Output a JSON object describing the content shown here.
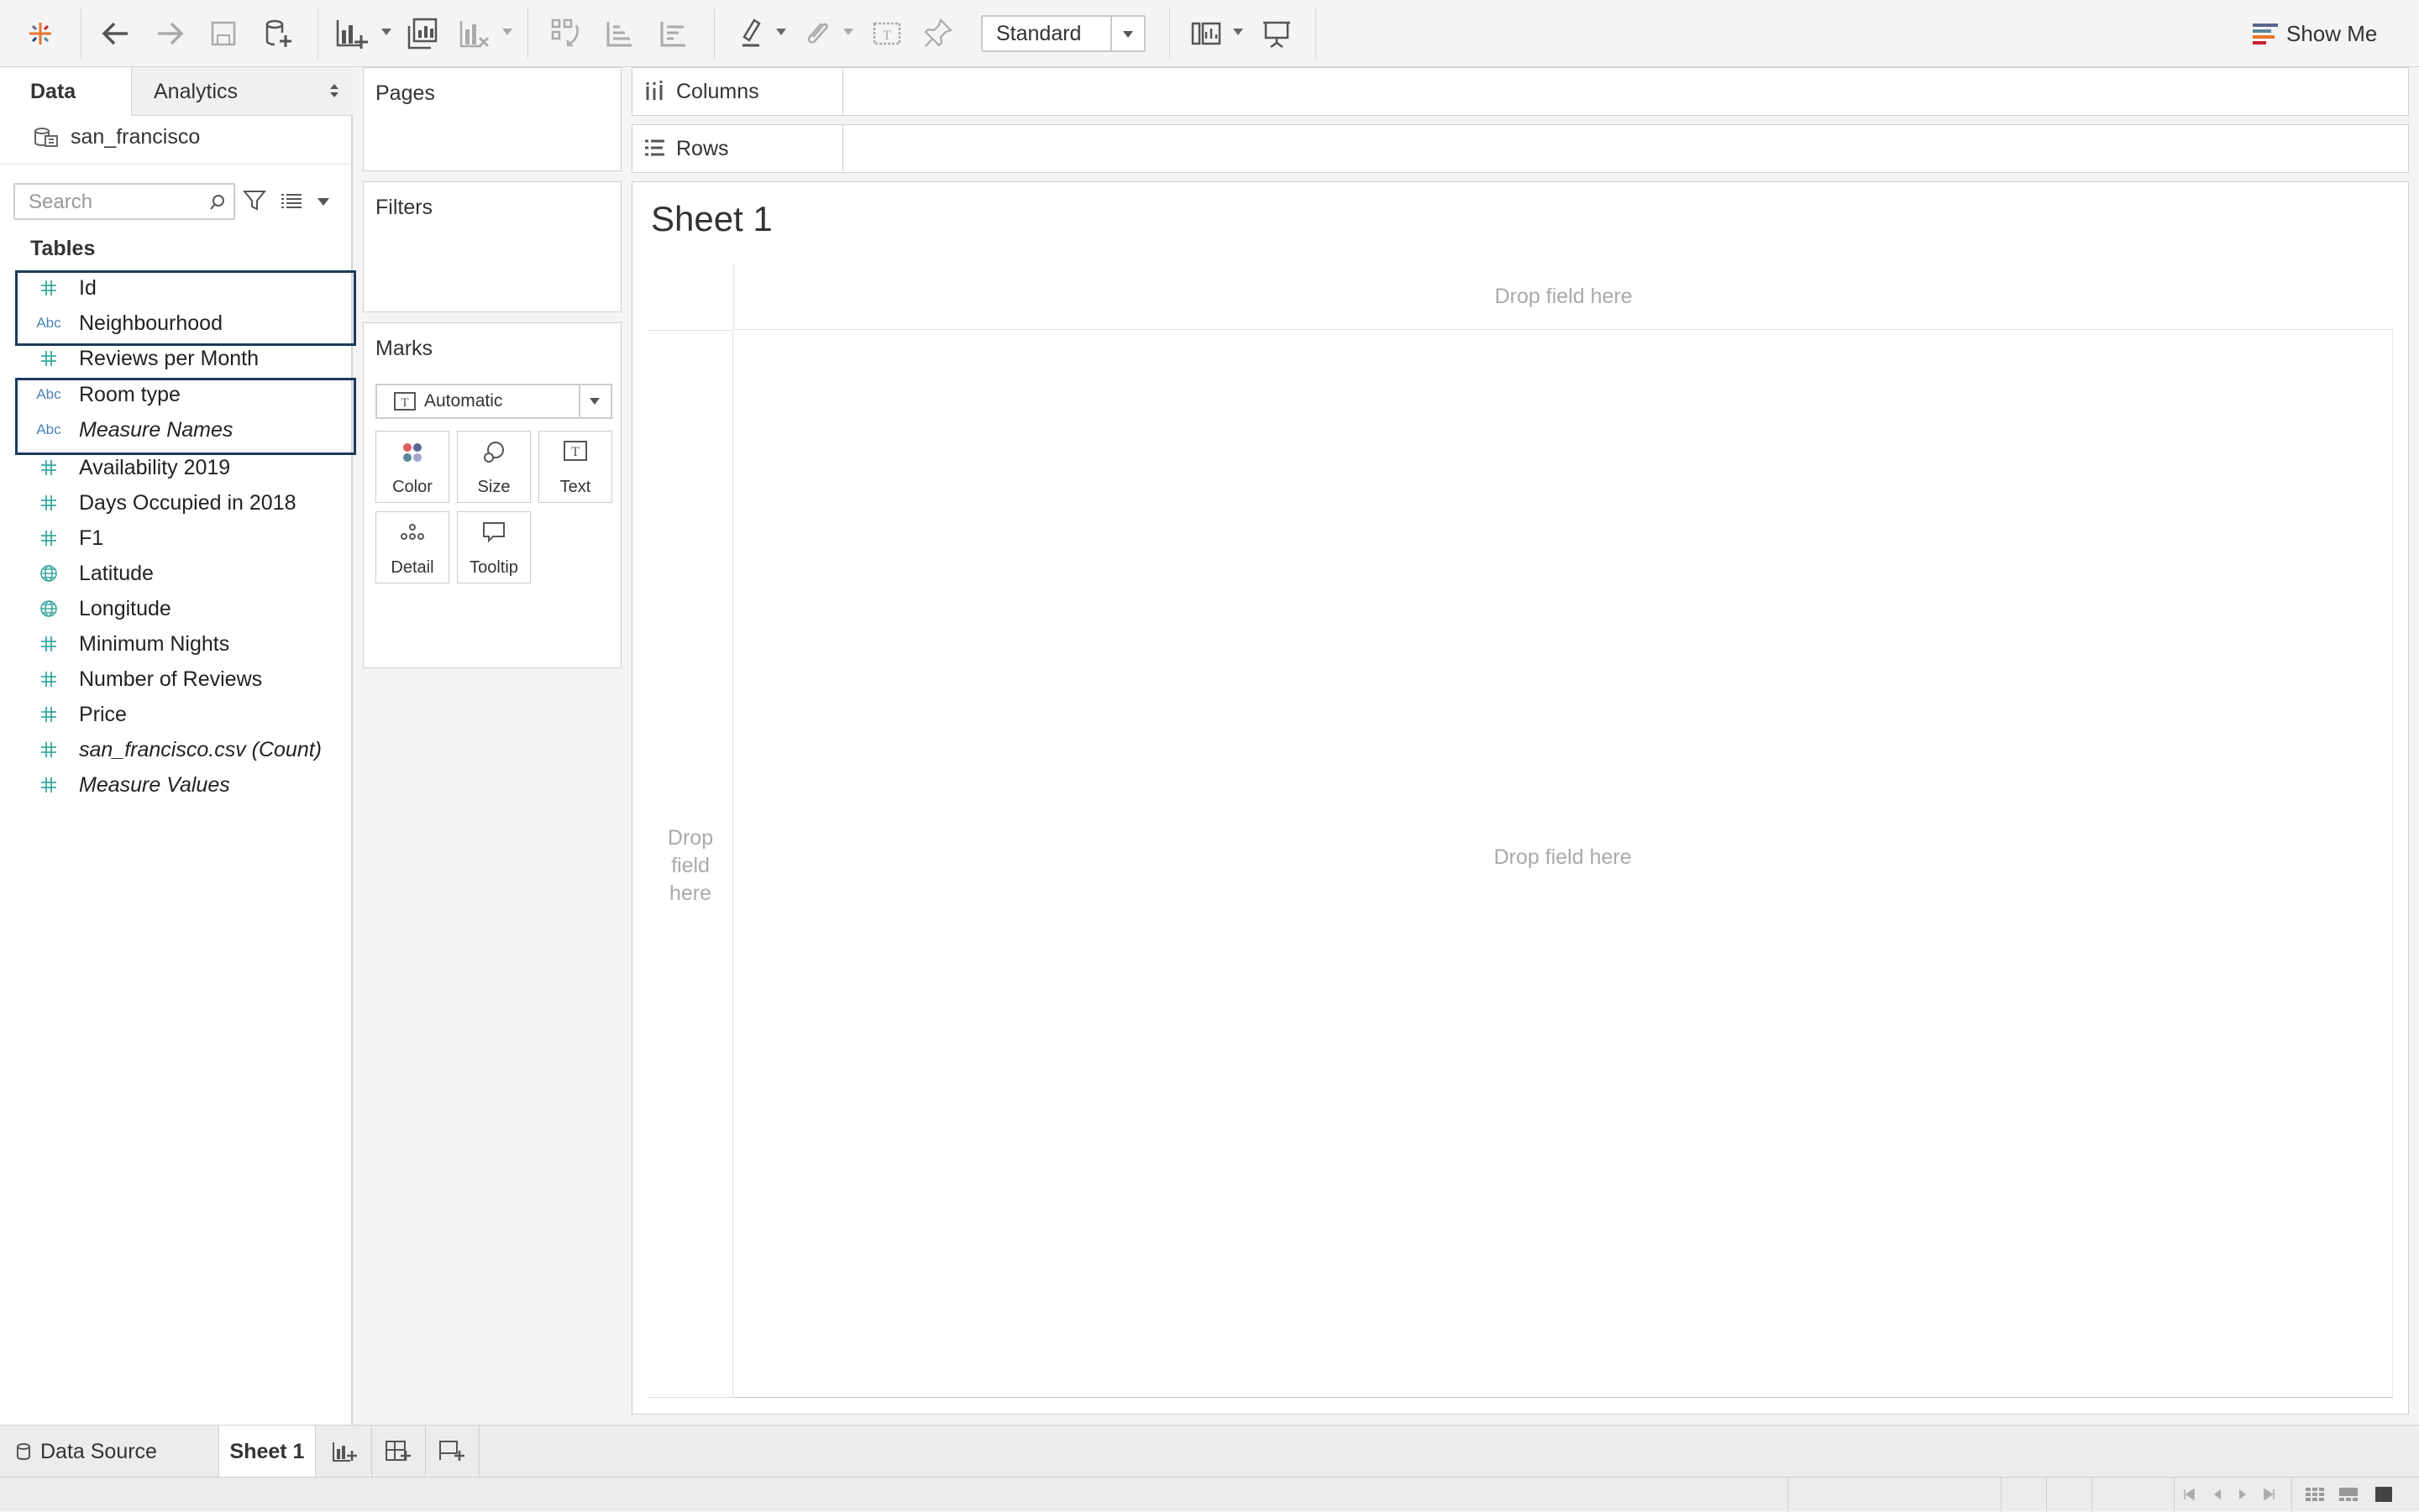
{
  "toolbar": {
    "fit_select": {
      "value": "Standard"
    },
    "show_me_label": "Show Me"
  },
  "data_pane": {
    "tabs": [
      {
        "label": "Data",
        "active": true
      },
      {
        "label": "Analytics",
        "active": false
      }
    ],
    "datasource": "san_francisco",
    "search": {
      "placeholder": "Search",
      "value": ""
    },
    "tables_heading": "Tables",
    "fields": [
      {
        "label": "Id",
        "type": "number",
        "italic": false,
        "selected": true
      },
      {
        "label": "Neighbourhood",
        "type": "string",
        "italic": false,
        "selected": true
      },
      {
        "label": "Reviews per Month",
        "type": "number",
        "italic": false,
        "selected": false
      },
      {
        "label": "Room type",
        "type": "string",
        "italic": false,
        "selected": true
      },
      {
        "label": "Measure Names",
        "type": "string",
        "italic": true,
        "selected": true
      },
      {
        "label": "Availability 2019",
        "type": "number",
        "italic": false,
        "selected": false
      },
      {
        "label": "Days Occupied in 2018",
        "type": "number",
        "italic": false,
        "selected": false
      },
      {
        "label": "F1",
        "type": "number",
        "italic": false,
        "selected": false
      },
      {
        "label": "Latitude",
        "type": "geo",
        "italic": false,
        "selected": false
      },
      {
        "label": "Longitude",
        "type": "geo",
        "italic": false,
        "selected": false
      },
      {
        "label": "Minimum Nights",
        "type": "number",
        "italic": false,
        "selected": false
      },
      {
        "label": "Number of Reviews",
        "type": "number",
        "italic": false,
        "selected": false
      },
      {
        "label": "Price",
        "type": "number",
        "italic": false,
        "selected": false
      },
      {
        "label": "san_francisco.csv (Count)",
        "type": "number",
        "italic": true,
        "selected": false
      },
      {
        "label": "Measure Values",
        "type": "number",
        "italic": true,
        "selected": false
      }
    ],
    "field_icons": {
      "number": "#",
      "string": "Abc",
      "geo": "globe-icon"
    }
  },
  "cards": {
    "pages": "Pages",
    "filters": "Filters",
    "marks": {
      "title": "Marks",
      "type": "Automatic",
      "buttons": [
        "Color",
        "Size",
        "Text",
        "Detail",
        "Tooltip"
      ]
    }
  },
  "shelves": {
    "columns": "Columns",
    "rows": "Rows"
  },
  "view": {
    "sheet_title": "Sheet 1",
    "drop_columns": "Drop field here",
    "drop_rows": "Drop field here",
    "drop_main": "Drop field here"
  },
  "sheet_tabs": {
    "data_source": "Data Source",
    "sheets": [
      "Sheet 1"
    ]
  },
  "colors": {
    "selection_border": "#1d3b5c",
    "number_icon": "#3aa8a0",
    "string_icon": "#4b82b8"
  }
}
